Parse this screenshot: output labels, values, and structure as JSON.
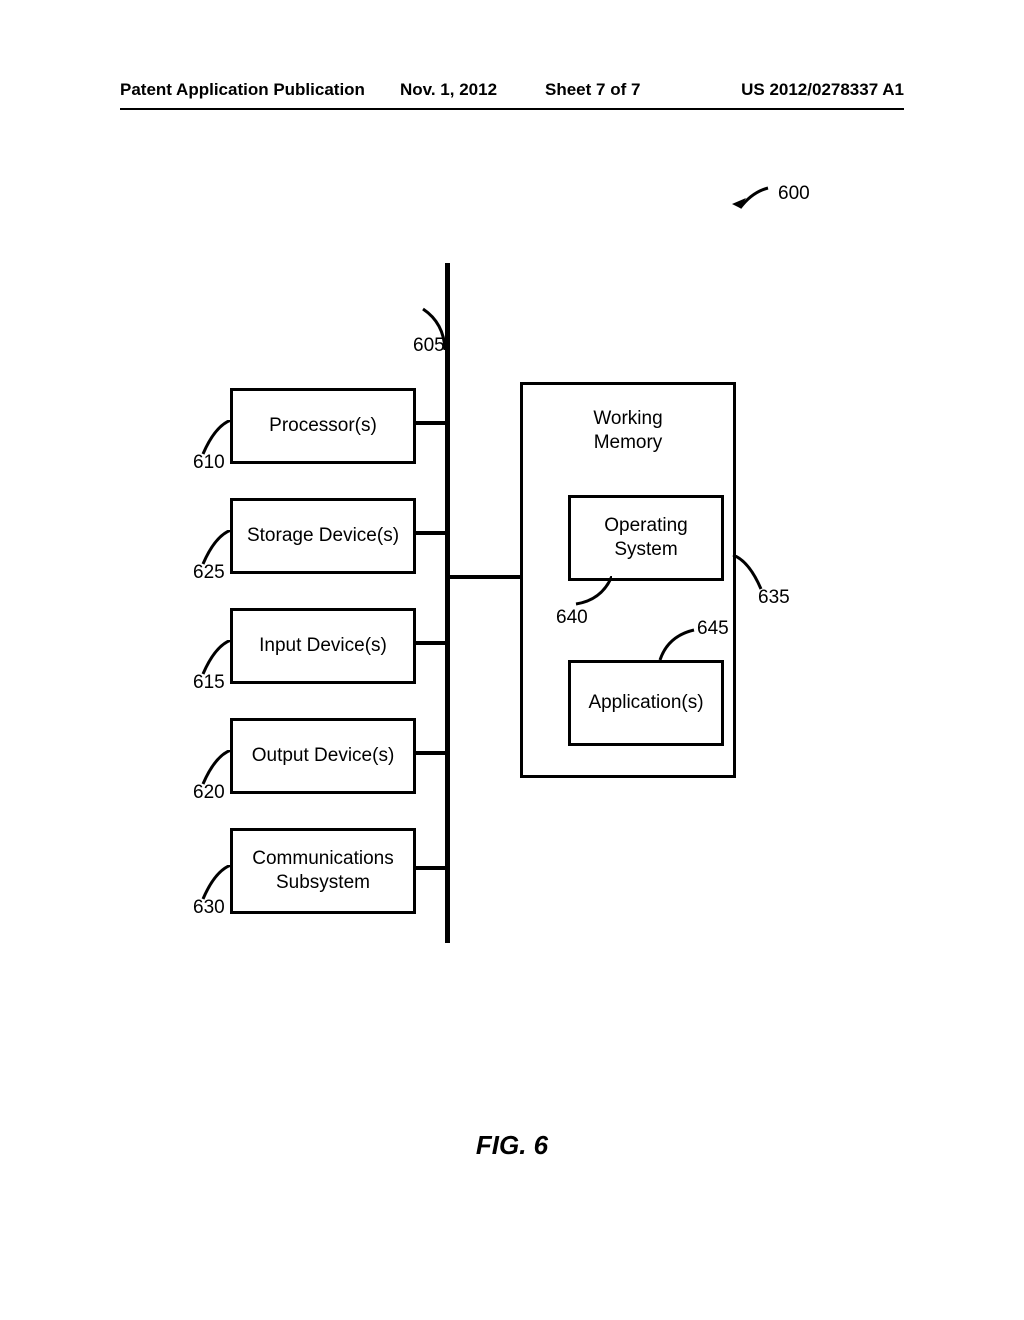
{
  "header": {
    "publication": "Patent Application Publication",
    "date": "Nov. 1, 2012",
    "sheet": "Sheet 7 of 7",
    "appno": "US 2012/0278337 A1"
  },
  "figure_caption": "FIG. 6",
  "refs": {
    "system": "600",
    "bus": "605",
    "processor": "610",
    "input": "615",
    "output": "620",
    "storage": "625",
    "comms": "630",
    "workingmem": "635",
    "os": "640",
    "app": "645"
  },
  "boxes": {
    "processor": "Processor(s)",
    "storage": "Storage Device(s)",
    "input": "Input Device(s)",
    "output": "Output Device(s)",
    "comms": "Communications\nSubsystem",
    "workingmem": "Working\nMemory",
    "os": "Operating\nSystem",
    "app": "Application(s)"
  }
}
